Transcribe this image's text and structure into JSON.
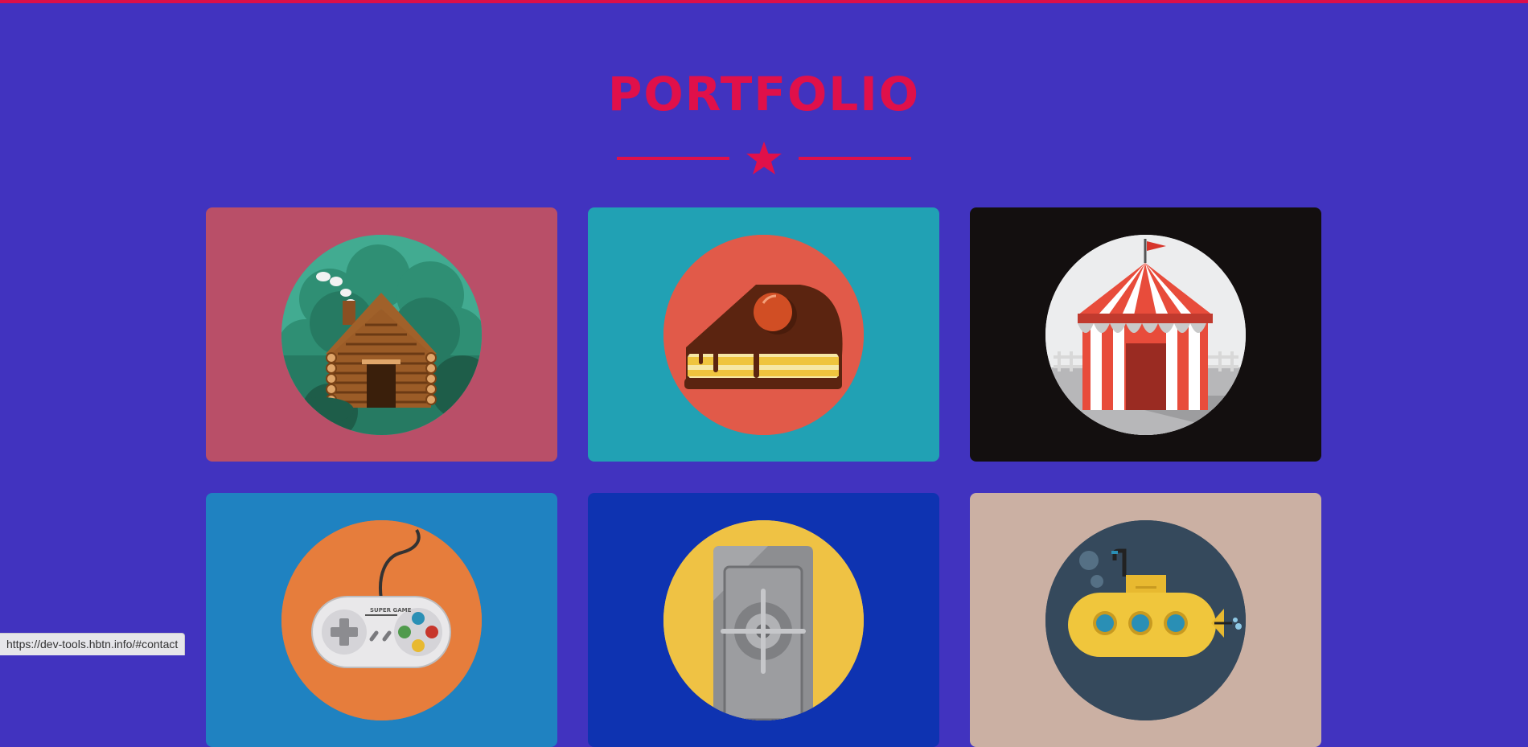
{
  "heading": {
    "title": "PORTFOLIO"
  },
  "colors": {
    "background": "#4133bf",
    "accent": "#e0104a"
  },
  "portfolio": {
    "items": [
      {
        "name": "log-cabin",
        "icon": "log-cabin-icon",
        "card_color": "#b94f68",
        "circle_color": "#3fa88e"
      },
      {
        "name": "cake",
        "icon": "cake-slice-icon",
        "card_color": "#21a1b4",
        "circle_color": "#e15a49"
      },
      {
        "name": "circus",
        "icon": "circus-tent-icon",
        "card_color": "#130f0f",
        "circle_color": "#ecedee"
      },
      {
        "name": "game-controller",
        "icon": "game-controller-icon",
        "card_color": "#1f82c1",
        "circle_color": "#e67d3c",
        "text": "SUPER GAME"
      },
      {
        "name": "safe",
        "icon": "safe-icon",
        "card_color": "#0e33b1",
        "circle_color": "#efc244"
      },
      {
        "name": "submarine",
        "icon": "submarine-icon",
        "card_color": "#cbb0a3",
        "circle_color": "#35495c"
      }
    ]
  },
  "status_bar": {
    "url": "https://dev-tools.hbtn.info/#contact"
  }
}
